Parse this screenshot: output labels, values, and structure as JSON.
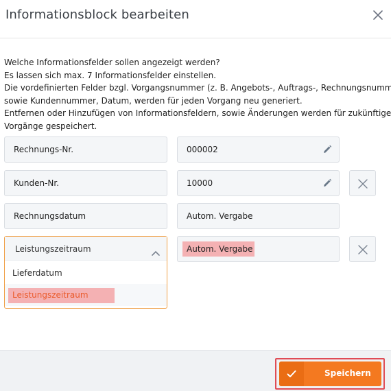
{
  "dialog": {
    "title": "Informationsblock bearbeiten",
    "close_icon": "close-icon"
  },
  "description": [
    "Welche Informationsfelder sollen angezeigt werden?",
    "Es lassen sich max. 7 Informationsfelder einstellen.",
    "Die vordefinierten Felder bzgl. Vorgangsnummer (z. B. Angebots-, Auftrags-, Rechnungsnummer),",
    "sowie Kundennummer, Datum, werden für jeden Vorgang neu generiert.",
    "Entfernen oder Hinzufügen von Informationsfeldern, sowie Änderungen werden für zukünftige",
    "Vorgänge gespeichert."
  ],
  "rows": [
    {
      "label": "Rechnungs-Nr.",
      "value": "000002",
      "editable": true,
      "removable": false
    },
    {
      "label": "Kunden-Nr.",
      "value": "10000",
      "editable": true,
      "removable": true
    },
    {
      "label": "Rechnungsdatum",
      "value": "Autom. Vergabe",
      "editable": false,
      "removable": false
    },
    {
      "label": "Leistungszeitraum",
      "value": "Autom. Vergabe",
      "editable": false,
      "removable": true
    }
  ],
  "dropdown": {
    "selected": "Leistungszeitraum",
    "options": [
      "Lieferdatum",
      "Leistungszeitraum"
    ]
  },
  "footer": {
    "save_label": "Speichern"
  },
  "colors": {
    "accent": "#f47920",
    "highlight": "#f4b1b3",
    "selected_text": "#ea5b2c",
    "outline": "#e04c55"
  }
}
